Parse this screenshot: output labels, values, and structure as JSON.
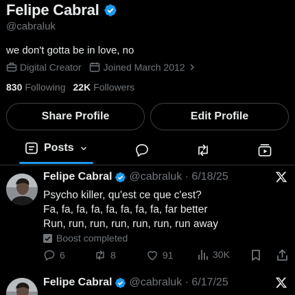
{
  "profile": {
    "name": "Felipe Cabral",
    "handle": "@cabraluk",
    "bio": "we don't gotta be in love, no",
    "category": "Digital Creator",
    "joined": "Joined March 2012",
    "following_count": "830",
    "following_label": "Following",
    "followers_count": "22K",
    "followers_label": "Followers",
    "share_label": "Share Profile",
    "edit_label": "Edit Profile"
  },
  "tabs": {
    "active_label": "Posts"
  },
  "posts": [
    {
      "name": "Felipe Cabral",
      "handle": "@cabraluk · 6/18/25",
      "lines": [
        "Psycho killer, qu'est ce que c'est?",
        "Fa, fa, fa, fa, fa, fa, fa, fa, far better",
        "Run, run, run, run, run, run, run away"
      ],
      "boost": "Boost completed",
      "replies": "6",
      "reposts": "8",
      "likes": "91",
      "views": "30K"
    },
    {
      "name": "Felipe Cabral",
      "handle": "@cabraluk · 6/17/25"
    }
  ],
  "colors": {
    "accent": "#1d9bf0",
    "muted": "#71767b",
    "text": "#e7e9ea",
    "border": "#3e4144"
  },
  "icons": [
    "verified-badge-icon",
    "briefcase-icon",
    "calendar-icon",
    "chevron-right-icon",
    "posts-icon",
    "chevron-down-icon",
    "replies-icon",
    "retweet-icon",
    "media-icon",
    "x-logo-icon",
    "boost-check-icon",
    "reply-icon",
    "like-icon",
    "views-icon",
    "bookmark-icon",
    "share-icon"
  ]
}
